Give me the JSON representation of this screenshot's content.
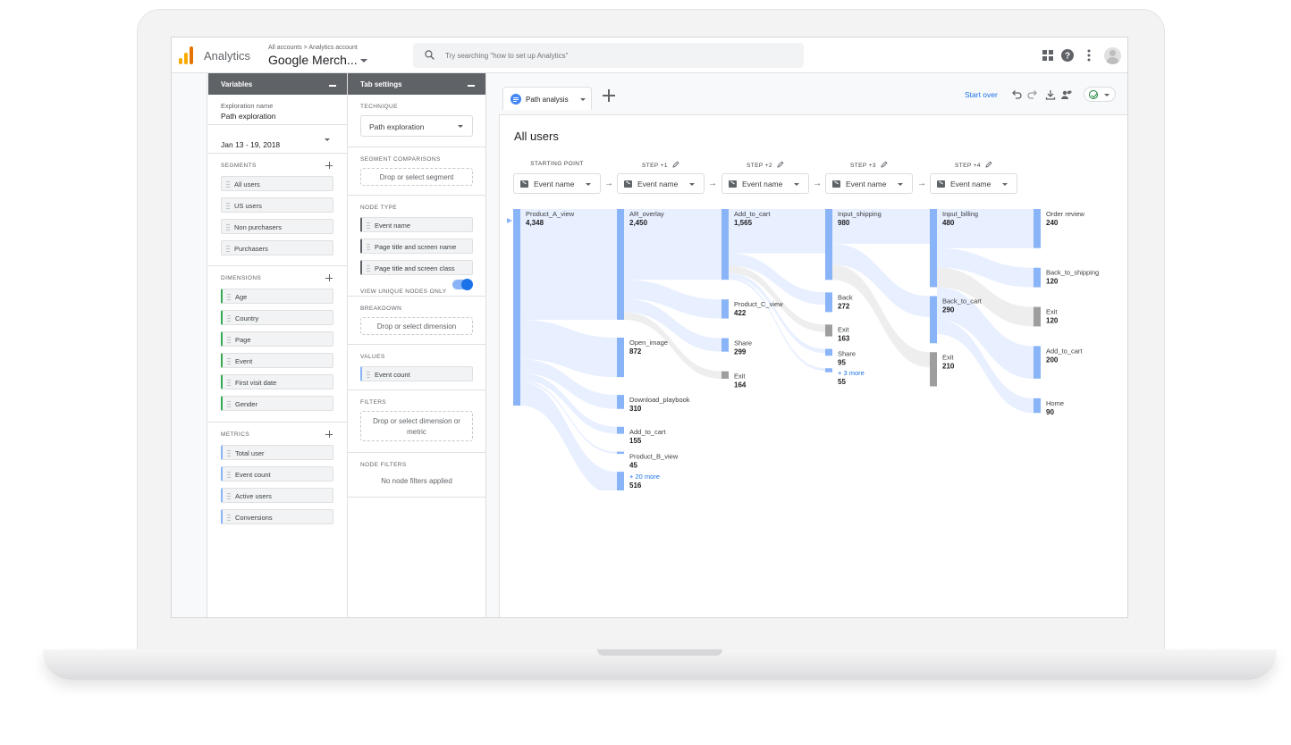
{
  "header": {
    "app_name": "Analytics",
    "breadcrumb": "All accounts > Analytics account",
    "account": "Google Merch...",
    "search_placeholder": "Try searching \"how to set up Analytics\"",
    "logo_colors": [
      "#f9ab00",
      "#e37400",
      "#e8710a"
    ]
  },
  "variables": {
    "title": "Variables",
    "exploration_label": "Exploration name",
    "exploration_name": "Path exploration",
    "date_range": "Jan 13 - 19, 2018",
    "segments_title": "SEGMENTS",
    "segments": [
      "All users",
      "US users",
      "Non purchasers",
      "Purchasers"
    ],
    "dimensions_title": "DIMENSIONS",
    "dimensions": [
      "Age",
      "Country",
      "Page",
      "Event",
      "First visit date",
      "Gender"
    ],
    "metrics_title": "METRICS",
    "metrics": [
      "Total user",
      "Event count",
      "Active users",
      "Conversions"
    ]
  },
  "tab_settings": {
    "title": "Tab settings",
    "technique_title": "TECHNIQUE",
    "technique": "Path exploration",
    "segment_comparisons_title": "SEGMENT COMPARISONS",
    "segment_drop": "Drop or select segment",
    "node_type_title": "NODE TYPE",
    "node_types": [
      "Event name",
      "Page title and screen name",
      "Page title and screen class"
    ],
    "unique_nodes_label": "VIEW UNIQUE NODES ONLY",
    "breakdown_title": "BREAKDOWN",
    "breakdown_drop": "Drop or select dimension",
    "values_title": "VALUES",
    "values_chip": "Event count",
    "filters_title": "FILTERS",
    "filters_drop": "Drop or select dimension or metric",
    "node_filters_title": "NODE FILTERS",
    "node_filters_text": "No node filters applied"
  },
  "main": {
    "tab_label": "Path analysis",
    "start_over": "Start over",
    "heading": "All users",
    "steps": [
      {
        "label": "STARTING POINT",
        "select": "Event name"
      },
      {
        "label": "STEP +1",
        "select": "Event name"
      },
      {
        "label": "STEP +2",
        "select": "Event name"
      },
      {
        "label": "STEP +3",
        "select": "Event name"
      },
      {
        "label": "STEP +4",
        "select": "Event name"
      }
    ]
  },
  "flow": {
    "accent": "#8ab4f8",
    "link_color": "#e8efff",
    "exit_color": "#9e9e9e",
    "columns": [
      [
        {
          "name": "Product_A_view",
          "value": 4348
        }
      ],
      [
        {
          "name": "AR_overlay",
          "value": 2450
        },
        {
          "name": "Open_image",
          "value": 872
        },
        {
          "name": "Download_playbook",
          "value": 310
        },
        {
          "name": "Add_to_cart",
          "value": 155
        },
        {
          "name": "Product_B_view",
          "value": 45
        },
        {
          "name": "+ 20 more",
          "value": 516,
          "more": true
        }
      ],
      [
        {
          "name": "Add_to_cart",
          "value": 1565
        },
        {
          "name": "Product_C_view",
          "value": 422
        },
        {
          "name": "Share",
          "value": 299
        },
        {
          "name": "Exit",
          "value": 164,
          "exit": true
        }
      ],
      [
        {
          "name": "Input_shipping",
          "value": 980
        },
        {
          "name": "Back",
          "value": 272
        },
        {
          "name": "Exit",
          "value": 163,
          "exit": true
        },
        {
          "name": "Share",
          "value": 95
        },
        {
          "name": "+ 3 more",
          "value": 55,
          "more": true
        }
      ],
      [
        {
          "name": "Input_billing",
          "value": 480
        },
        {
          "name": "Back_to_cart",
          "value": 290
        },
        {
          "name": "Exit",
          "value": 210,
          "exit": true
        }
      ],
      [
        {
          "name": "Order review",
          "value": 240
        },
        {
          "name": "Back_to_shipping",
          "value": 120
        },
        {
          "name": "Exit",
          "value": 120,
          "exit": true
        },
        {
          "name": "Add_to_cart",
          "value": 200
        },
        {
          "name": "Home",
          "value": 90
        }
      ]
    ]
  }
}
